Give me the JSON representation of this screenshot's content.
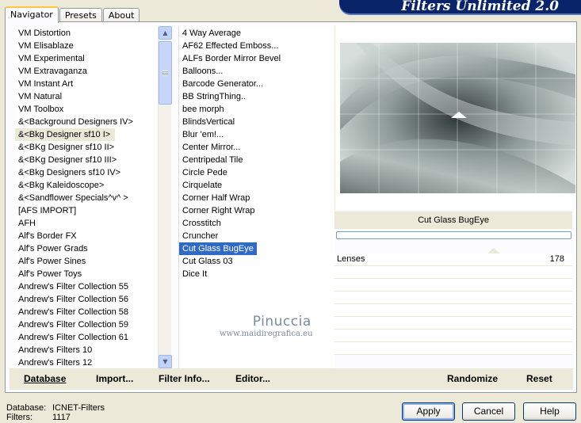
{
  "window": {
    "title": "Filters Unlimited 2.0"
  },
  "tabs": [
    {
      "label": "Navigator",
      "active": true
    },
    {
      "label": "Presets",
      "active": false
    },
    {
      "label": "About",
      "active": false
    }
  ],
  "categories": {
    "items": [
      "VM Distortion",
      "VM Elisablaze",
      "VM Experimental",
      "VM Extravaganza",
      "VM Instant Art",
      "VM Natural",
      "VM Toolbox",
      "&<Background Designers IV>",
      "&<Bkg Designer sf10 I>",
      "&<BKg Designer sf10 II>",
      "&<BKg Designer sf10 III>",
      "&<Bkg Designers sf10 IV>",
      "&<Bkg Kaleidoscope>",
      "&<Sandflower Specials^v^ >",
      "[AFS IMPORT]",
      "AFH",
      "Alf's Border FX",
      "Alf's Power Grads",
      "Alf's Power Sines",
      "Alf's Power Toys",
      "Andrew's Filter Collection 55",
      "Andrew's Filter Collection 56",
      "Andrew's Filter Collection 58",
      "Andrew's Filter Collection 59",
      "Andrew's Filter Collection 61",
      "Andrew's Filters 10",
      "Andrew's Filters 12"
    ],
    "focused": "&<Bkg Designer sf10 I>"
  },
  "filters": {
    "items": [
      "4 Way Average",
      "AF62 Effected Emboss...",
      "ALFs Border Mirror Bevel",
      "Balloons...",
      "Barcode Generator...",
      "BB StringThing..",
      "bee morph",
      "BlindsVertical",
      "Blur 'em!...",
      "Center Mirror...",
      "Centripedal Tile",
      "Circle Pede",
      "Cirquelate",
      "Corner Half Wrap",
      "Corner Right Wrap",
      "Crosstitch",
      "Cruncher",
      "Cut Glass  BugEye",
      "Cut Glass 03",
      "Dice It"
    ],
    "selected": "Cut Glass  BugEye"
  },
  "preview": {
    "filter_name": "Cut Glass  BugEye",
    "image_subject": "grey-glass-swirl-preview"
  },
  "params": [
    {
      "label": "Lenses",
      "value": "178"
    },
    {
      "label": "",
      "value": ""
    },
    {
      "label": "",
      "value": ""
    },
    {
      "label": "",
      "value": ""
    },
    {
      "label": "",
      "value": ""
    },
    {
      "label": "",
      "value": ""
    },
    {
      "label": "",
      "value": ""
    },
    {
      "label": "",
      "value": ""
    }
  ],
  "watermark": {
    "line1": "Pinuccia",
    "line2": "www.maidiregrafica.eu"
  },
  "actions": {
    "database": "Database",
    "import": "Import...",
    "filter_info": "Filter Info...",
    "editor": "Editor...",
    "randomize": "Randomize",
    "reset": "Reset"
  },
  "status": {
    "database_label": "Database:",
    "database_value": "ICNET-Filters",
    "filters_label": "Filters:",
    "filters_value": "1117"
  },
  "buttons": {
    "apply": "Apply",
    "cancel": "Cancel",
    "help": "Help"
  },
  "colors": {
    "selection": "#316ac5",
    "banner": "#0a246a",
    "face": "#ece9d8"
  }
}
